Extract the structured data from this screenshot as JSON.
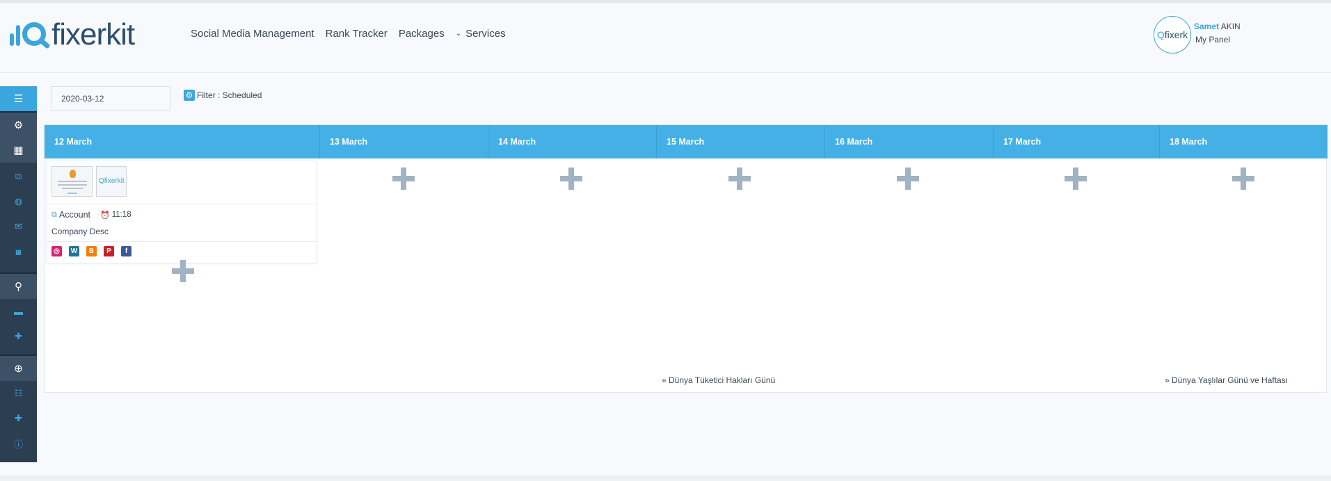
{
  "app": {
    "logo_text": "fixerkit"
  },
  "nav": {
    "items": [
      "Social Media Management",
      "Rank Tracker",
      "Packages",
      "Services"
    ]
  },
  "user": {
    "first_name": "Samet",
    "last_name": "AKIN",
    "panel_label": "My Panel",
    "avatar_text": "fixerk"
  },
  "toolbar": {
    "date_value": "2020-03-12",
    "filter_label": "Filter : Scheduled"
  },
  "calendar": {
    "days": [
      "12 March",
      "13 March",
      "14 March",
      "15 March",
      "16 March",
      "17 March",
      "18 March"
    ],
    "post": {
      "account_label": "Account",
      "time": "11:18",
      "description": "Company Desc",
      "networks": [
        "instagram",
        "wordpress",
        "blogger",
        "pinterest",
        "facebook"
      ]
    },
    "events": [
      {
        "day": "15 March",
        "label": "» Dünya Tüketici Hakları Günü"
      },
      {
        "day": "18 March",
        "label": "» Dünya Yaşlılar Günü ve Haftası"
      }
    ]
  },
  "sidebar": {
    "icons": [
      "sliders-icon",
      "gear-icon",
      "grid-icon",
      "sitemap-icon",
      "globe-icon",
      "mail-icon",
      "rss-icon",
      "search-icon",
      "folder-icon",
      "plus-icon",
      "lifebuoy-icon",
      "list-icon",
      "plus-icon",
      "info-icon"
    ]
  },
  "colors": {
    "accent": "#3aa6dd",
    "header_blue": "#44b0e6",
    "sidebar": "#2b3e52",
    "plus": "#9fb3c4"
  }
}
